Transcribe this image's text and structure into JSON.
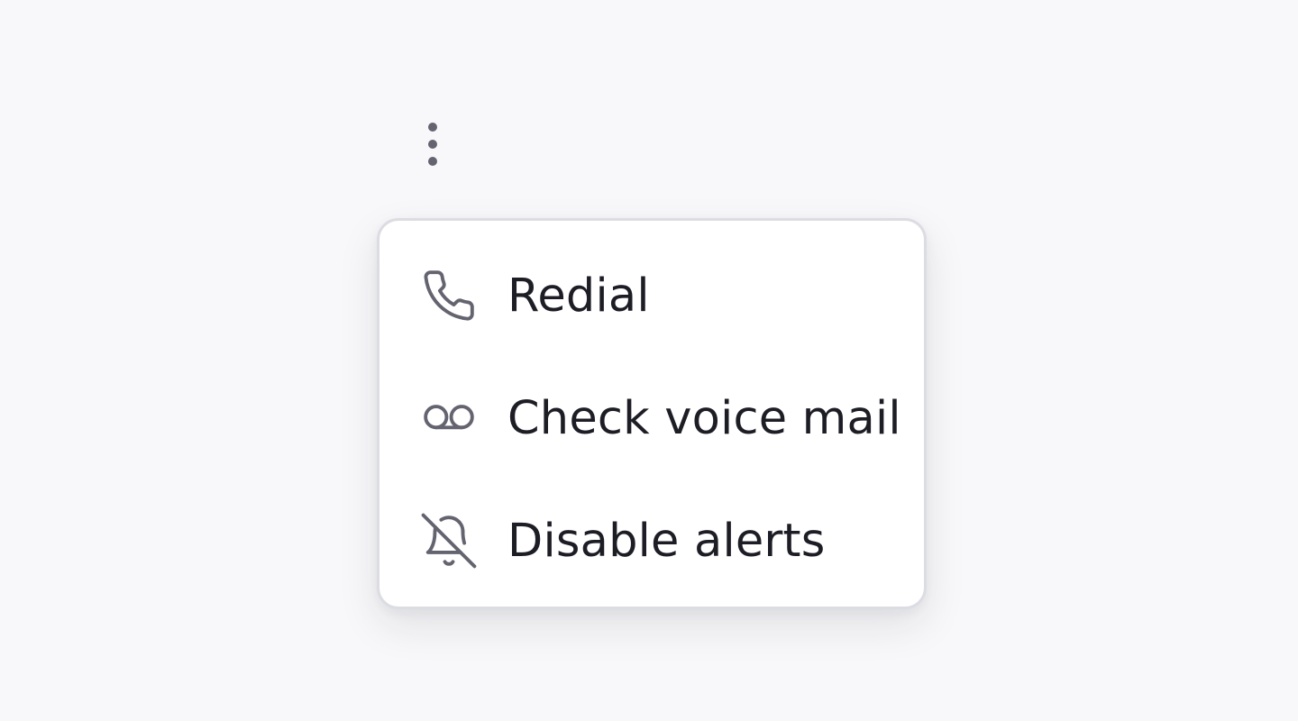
{
  "trigger": {
    "icon": "more-vertical-icon"
  },
  "menu": {
    "items": [
      {
        "label": "Redial",
        "icon": "phone-icon"
      },
      {
        "label": "Check voice mail",
        "icon": "voicemail-icon"
      },
      {
        "label": "Disable alerts",
        "icon": "bell-off-icon"
      }
    ]
  },
  "colors": {
    "background": "#f8f8fa",
    "menu_background": "#ffffff",
    "menu_border": "#dcdce3",
    "icon": "#646470",
    "text": "#1d1d25"
  }
}
